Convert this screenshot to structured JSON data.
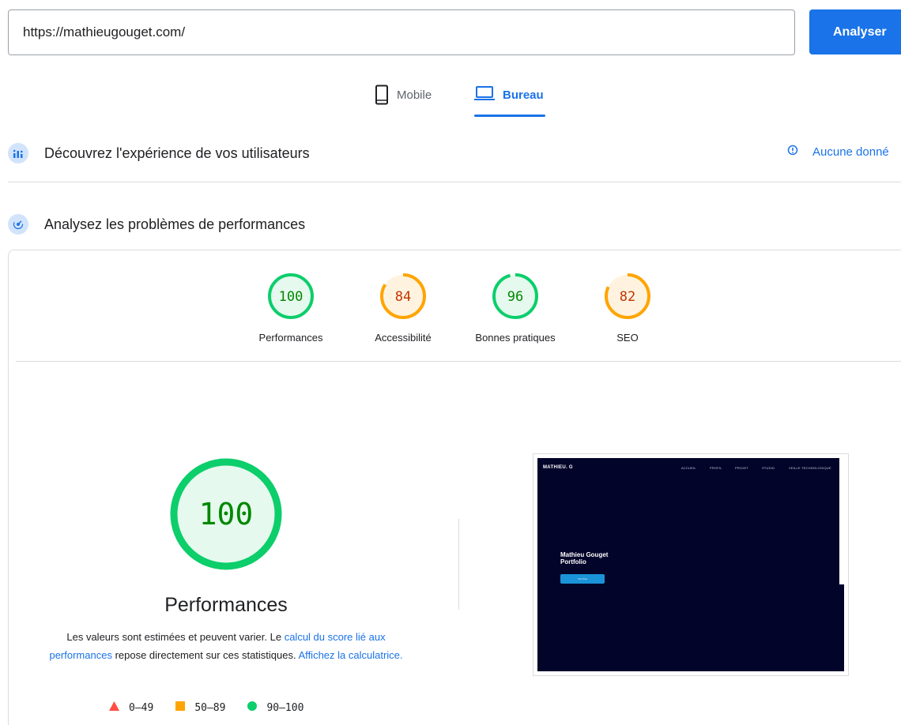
{
  "search": {
    "url_value": "https://mathieugouget.com/",
    "analyze_label": "Analyser"
  },
  "device_tabs": {
    "mobile": "Mobile",
    "desktop": "Bureau",
    "selected": "desktop"
  },
  "field_data": {
    "title": "Découvrez l'expérience de vos utilisateurs",
    "no_data": "Aucune donné"
  },
  "lab_data": {
    "title": "Analysez les problèmes de performances"
  },
  "gauges": [
    {
      "key": "performance",
      "score": "100",
      "value": 100,
      "label": "Performances",
      "status": "pass"
    },
    {
      "key": "accessibility",
      "score": "84",
      "value": 84,
      "label": "Accessibilité",
      "status": "average"
    },
    {
      "key": "best-practices",
      "score": "96",
      "value": 96,
      "label": "Bonnes pratiques",
      "status": "pass"
    },
    {
      "key": "seo",
      "score": "82",
      "value": 82,
      "label": "SEO",
      "status": "average"
    }
  ],
  "performance_detail": {
    "score": "100",
    "value": 100,
    "title": "Performances",
    "desc_part1": "Les valeurs sont estimées et peuvent varier. Le ",
    "desc_link1": "calcul du score lié aux performances",
    "desc_part2": " repose directement sur ces statistiques. ",
    "desc_link2": "Affichez la calculatrice."
  },
  "legend": {
    "fail": "0–49",
    "average": "50–89",
    "pass": "90–100"
  },
  "colors": {
    "accent": "#1a73e8",
    "pass": "#0cce6b",
    "pass_text": "#008800",
    "pass_bg": "#e6f9ee",
    "average": "#ffa400",
    "average_text": "#c33300",
    "average_bg": "#fff3e0",
    "fail": "#ff4e42"
  },
  "screenshot_preview": {
    "brand": "MATHIEU. G",
    "nav": [
      "ACCUEIL",
      "PROFIL",
      "PROJET",
      "STUDIO",
      "VEILLE TECHNOLOGIQUE"
    ],
    "hero_line1": "Mathieu Gouget",
    "hero_line2": "Portfolio",
    "button": "Voir Plus"
  }
}
